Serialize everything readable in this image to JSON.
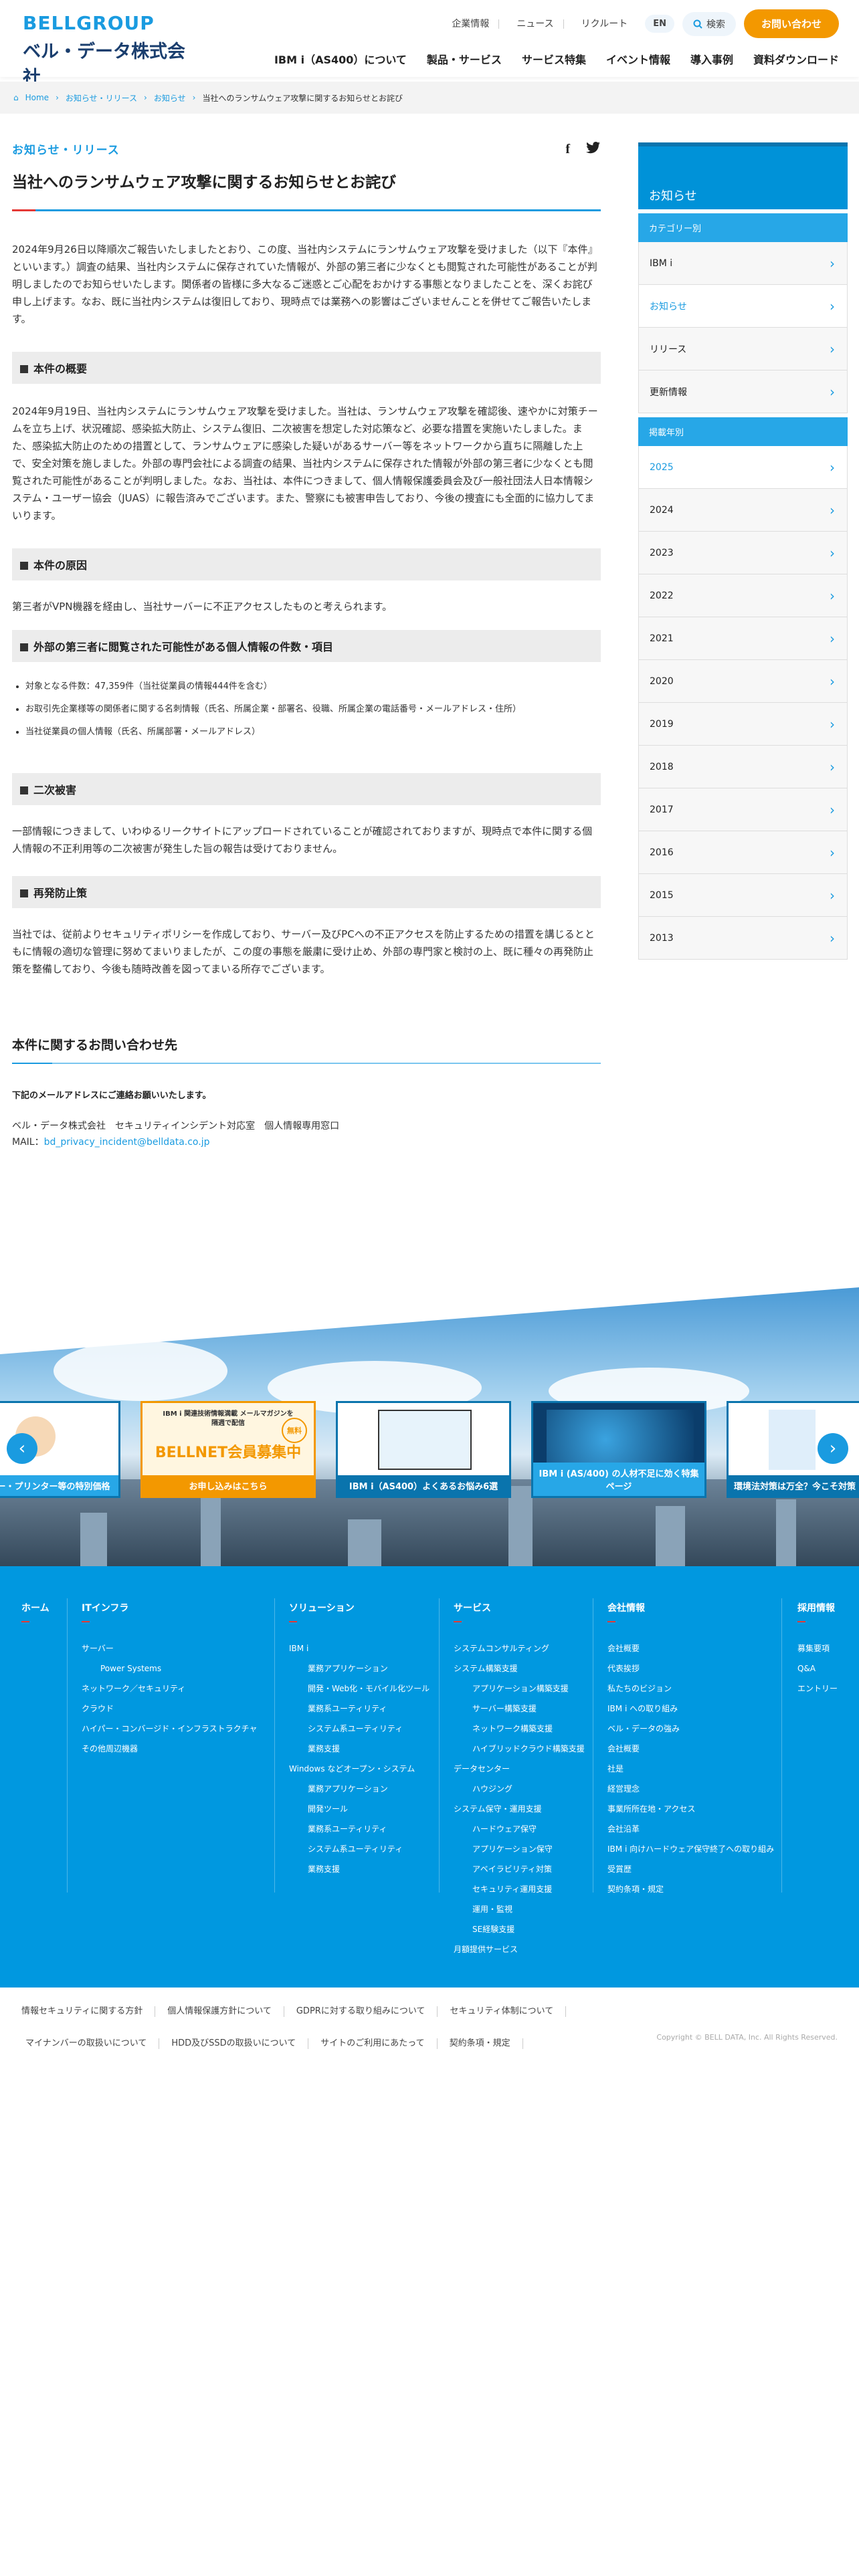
{
  "header": {
    "logo_top": "BELLGROUP",
    "logo_sub": "ベル・データ株式会社",
    "util_links": [
      "企業情報",
      "ニュース",
      "リクルート"
    ],
    "lang": "EN",
    "search": "検索",
    "contact": "お問い合わせ",
    "nav": [
      "IBM i（AS400）について",
      "製品・サービス",
      "サービス特集",
      "イベント情報",
      "導入事例",
      "資料ダウンロード"
    ]
  },
  "breadcrumb": [
    "Home",
    "お知らせ・リリース",
    "お知らせ",
    "当社へのランサムウェア攻撃に関するお知らせとお詫び"
  ],
  "article": {
    "category": "お知らせ・リリース",
    "title": "当社へのランサムウェア攻撃に関するお知らせとお詫び",
    "intro": "2024年9月26日以降順次ご報告いたしましたとおり、この度、当社内システムにランサムウェア攻撃を受けました（以下『本件』といいます。）調査の結果、当社内システムに保存されていた情報が、外部の第三者に少なくとも閲覧された可能性があることが判明しましたのでお知らせいたします。関係者の皆様に多大なるご迷惑とご心配をおかけする事態となりましたことを、深くお詫び申し上げます。なお、既に当社内システムは復旧しており、現時点では業務への影響はございませんことを併せてご報告いたします。",
    "sections": [
      {
        "heading": "本件の概要",
        "body": "2024年9月19日、当社内システムにランサムウェア攻撃を受けました。当社は、ランサムウェア攻撃を確認後、速やかに対策チームを立ち上げ、状況確認、感染拡大防止、システム復旧、二次被害を想定した対応策など、必要な措置を実施いたしました。また、感染拡大防止のための措置として、ランサムウェアに感染した疑いがあるサーバー等をネットワークから直ちに隔離した上で、安全対策を施しました。外部の専門会社による調査の結果、当社内システムに保存された情報が外部の第三者に少なくとも閲覧された可能性があることが判明しました。なお、当社は、本件につきまして、個人情報保護委員会及び一般社団法人日本情報システム・ユーザー協会（JUAS）に報告済みでございます。また、警察にも被害申告しており、今後の捜査にも全面的に協力してまいります。"
      },
      {
        "heading": "本件の原因",
        "body": "第三者がVPN機器を経由し、当社サーバーに不正アクセスしたものと考えられます。"
      },
      {
        "heading": "外部の第三者に閲覧された可能性がある個人情報の件数・項目",
        "items": [
          "対象となる件数：47,359件（当社従業員の情報444件を含む）",
          "お取引先企業様等の関係者に関する名刺情報（氏名、所属企業・部署名、役職、所属企業の電話番号・メールアドレス・住所）",
          "当社従業員の個人情報（氏名、所属部署・メールアドレス）"
        ]
      },
      {
        "heading": "二次被害",
        "body": "一部情報につきまして、いわゆるリークサイトにアップロードされていることが確認されておりますが、現時点で本件に関する個人情報の不正利用等の二次被害が発生した旨の報告は受けておりません。"
      },
      {
        "heading": "再発防止策",
        "body": "当社では、従前よりセキュリティポリシーを作成しており、サーバー及びPCへの不正アクセスを防止するための措置を講じるとともに情報の適切な管理に努めてまいりましたが、この度の事態を厳粛に受け止め、外部の専門家と検討の上、既に種々の再発防止策を整備しており、今後も随時改善を図ってまいる所存でございます。"
      }
    ],
    "contact_heading": "本件に関するお問い合わせ先",
    "contact_lead": "下記のメールアドレスにご連絡お願いいたします。",
    "contact_org": "ベル・データ株式会社　セキュリティインシデント対応室　個人情報専用窓口",
    "contact_mail_label": "MAIL：",
    "contact_mail": "bd_privacy_incident@belldata.co.jp"
  },
  "sidebar": {
    "title": "お知らせ",
    "cat_label": "カテゴリー別",
    "categories": [
      "IBM i",
      "お知らせ",
      "リリース",
      "更新情報"
    ],
    "year_label": "掲載年別",
    "years": [
      "2025",
      "2024",
      "2023",
      "2022",
      "2021",
      "2020",
      "2019",
      "2018",
      "2017",
      "2016",
      "2015",
      "2013"
    ]
  },
  "banners": [
    {
      "caption": "ー・プリンター等の特別価格"
    },
    {
      "caption": "お申し込みはこちら",
      "title": "BELLNET会員募集中",
      "sub": "IBM i 関連技術情報満載 メールマガジンを隔週で配信",
      "badge": "無料"
    },
    {
      "caption": "IBM i（AS400）よくあるお悩み6選"
    },
    {
      "caption": "IBM i (AS/400) の人材不足に効く特集ページ"
    },
    {
      "caption": "環境法対策は万全？今こそ対策"
    }
  ],
  "footer": {
    "home": "ホーム",
    "it": {
      "t": "ITインフラ",
      "items": [
        [
          "サーバー",
          0
        ],
        [
          "Power Systems",
          1
        ],
        [
          "ネットワーク／セキュリティ",
          0
        ],
        [
          "クラウド",
          0
        ],
        [
          "ハイパー・コンバージド・インフラストラクチャ",
          0
        ],
        [
          "その他周辺機器",
          0
        ]
      ]
    },
    "sol": {
      "t": "ソリューション",
      "items": [
        [
          "IBM i",
          0
        ],
        [
          "業務アプリケーション",
          1
        ],
        [
          "開発・Web化・モバイル化ツール",
          1
        ],
        [
          "業務系ユーティリティ",
          1
        ],
        [
          "システム系ユーティリティ",
          1
        ],
        [
          "業務支援",
          1
        ],
        [
          "Windows などオープン・システム",
          0
        ],
        [
          "業務アプリケーション",
          1
        ],
        [
          "開発ツール",
          1
        ],
        [
          "業務系ユーティリティ",
          1
        ],
        [
          "システム系ユーティリティ",
          1
        ],
        [
          "業務支援",
          1
        ]
      ]
    },
    "svc": {
      "t": "サービス",
      "items": [
        [
          "システムコンサルティング",
          0
        ],
        [
          "システム構築支援",
          0
        ],
        [
          "アプリケーション構築支援",
          1
        ],
        [
          "サーバー構築支援",
          1
        ],
        [
          "ネットワーク構築支援",
          1
        ],
        [
          "ハイブリッドクラウド構築支援",
          1
        ],
        [
          "データセンター",
          0
        ],
        [
          "ハウジング",
          1
        ],
        [
          "システム保守・運用支援",
          0
        ],
        [
          "ハードウェア保守",
          1
        ],
        [
          "アプリケーション保守",
          1
        ],
        [
          "アベイラビリティ対策",
          1
        ],
        [
          "セキュリティ運用支援",
          1
        ],
        [
          "運用・監視",
          1
        ],
        [
          "SE経験支援",
          1
        ],
        [
          "月額提供サービス",
          0
        ]
      ]
    },
    "co": {
      "t": "会社情報",
      "items": [
        "会社概要",
        "代表挨拶",
        "私たちのビジョン",
        "IBM i への取り組み",
        "ベル・データの強み",
        "会社概要",
        "社是",
        "経営理念",
        "事業所所在地・アクセス",
        "会社沿革",
        "IBM i 向けハードウェア保守終了への取り組み",
        "受賞歴",
        "契約条項・規定"
      ]
    },
    "rec": {
      "t": "採用情報",
      "items": [
        "募集要項",
        "Q&A",
        "エントリー"
      ]
    }
  },
  "bottom": {
    "links": [
      "情報セキュリティに関する方針",
      "個人情報保護方針について",
      "GDPRに対する取り組みについて",
      "セキュリティ体制について",
      "マイナンバーの取扱いについて",
      "HDD及びSSDの取扱いについて",
      "サイトのご利用にあたって",
      "契約条項・規定"
    ],
    "copyright": "Copyright © BELL DATA, Inc. All Rights Reserved."
  },
  "colors": {
    "brand": "#1a9be0",
    "accent": "#f39800",
    "footer": "#0098e0"
  }
}
